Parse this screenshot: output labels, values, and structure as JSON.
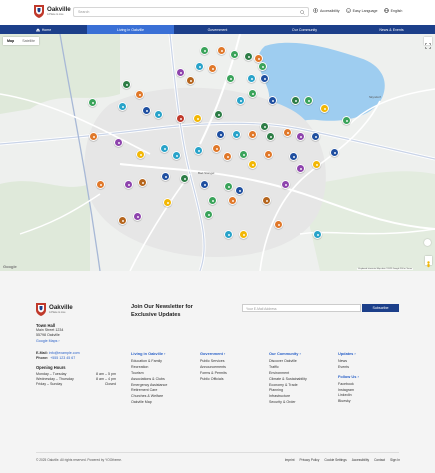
{
  "header": {
    "logo_name": "Oakville",
    "logo_sub": "A Place to Live",
    "search_placeholder": "Search",
    "tools": [
      {
        "label": "Accessibility",
        "icon": "accessibility-icon"
      },
      {
        "label": "Easy Language",
        "icon": "easy-language-icon"
      },
      {
        "label": "English",
        "icon": "globe-icon"
      }
    ]
  },
  "nav": {
    "items": [
      {
        "label": "Home",
        "icon": "home-icon"
      },
      {
        "label": "Living in Oakville"
      },
      {
        "label": "Government"
      },
      {
        "label": "Our Community"
      },
      {
        "label": "News & Events"
      }
    ]
  },
  "map": {
    "toggle": [
      "Map",
      "Satellite"
    ],
    "brand": "Google",
    "attribution": "Keyboard shortcuts   Map data ©2025 Google   500 m   Terms",
    "place_labels": [
      "Skyndorf",
      "Bad Stangel"
    ],
    "pin_colors": [
      "#3aa35a",
      "#2d7d46",
      "#e0782a",
      "#f2b705",
      "#8e44ad",
      "#1f4fa0",
      "#29a3c9",
      "#c0392b",
      "#b5651d"
    ]
  },
  "footer": {
    "logo_name": "Oakville",
    "logo_sub": "A Place to Live",
    "address_title": "Town Hall",
    "address_lines": [
      "Main Street 1234",
      "55798 Oakville"
    ],
    "maps_link": "Google Maps ›",
    "email_label": "E-Mail:",
    "email": "info@example.com",
    "phone_label": "Phone:",
    "phone": "+555 123 45 67",
    "hours_title": "Opening Hours",
    "hours": [
      {
        "day": "Monday – Tuesday",
        "time": "8 am – 5 pm"
      },
      {
        "day": "Wednesday – Thursday",
        "time": "8 am – 4 pm"
      },
      {
        "day": "Friday – Sunday",
        "time": "Closed"
      }
    ],
    "newsletter_title": "Join Our Newsletter for Exclusive Updates",
    "newsletter_placeholder": "Your E-Mail Address",
    "subscribe": "Subscribe",
    "columns": [
      {
        "title": "Living in Oakville ›",
        "items": [
          "Education & Family",
          "Recreation",
          "Tourism",
          "Associations & Clubs",
          "Emergency Assistance",
          "Retirement Care",
          "Churches & Welfare",
          "Oakville Map"
        ]
      },
      {
        "title": "Government ›",
        "items": [
          "Public Services",
          "Announcements",
          "Forms & Permits",
          "Public Officials"
        ]
      },
      {
        "title": "Our Community ›",
        "items": [
          "Discover Oakville",
          "Traffic",
          "Environment",
          "Climate & Sustainability",
          "Economy & Trade",
          "Planning",
          "Infrastructure",
          "Security & Order"
        ]
      },
      {
        "title": "Updates ›",
        "items": [
          "News",
          "Events"
        ],
        "title2": "Follow Us ›",
        "items2": [
          "Facebook",
          "Instagram",
          "LinkedIn",
          "Bluesky"
        ]
      }
    ],
    "copyright": "© 2025 Oakville. All rights reserved. Powered by YOOtheme.",
    "bottom_links": [
      "Imprint",
      "Privacy Policy",
      "Cookie Settings",
      "Accessibility",
      "Contact",
      "Sign In"
    ]
  }
}
